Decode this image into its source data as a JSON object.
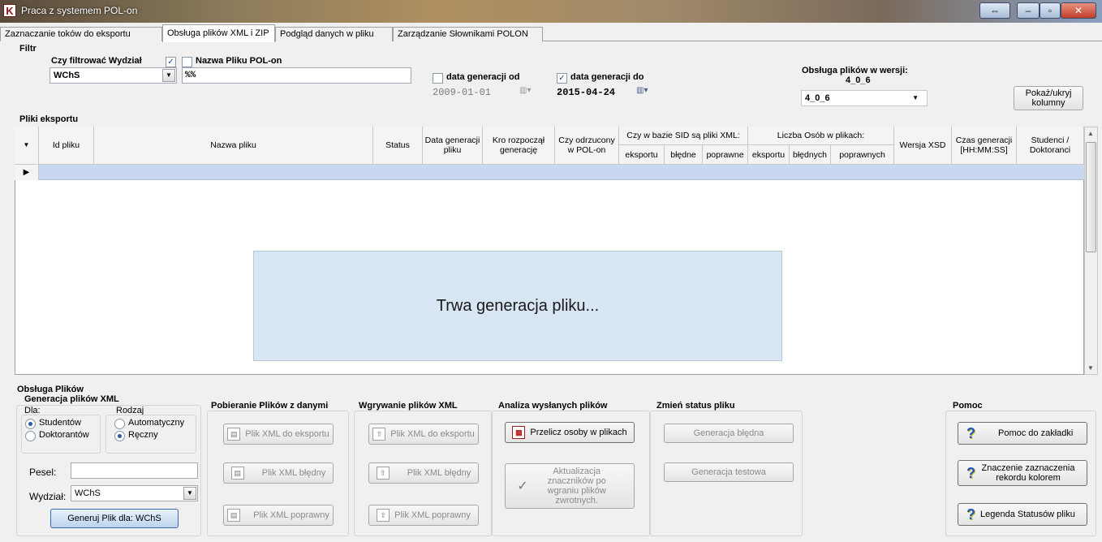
{
  "window": {
    "title": "Praca z systemem POL-on",
    "icon": "app-logo-icon"
  },
  "tabs": [
    {
      "label": "Zaznaczanie toków do eksportu"
    },
    {
      "label": "Obsługa plików XML i ZIP"
    },
    {
      "label": "Podgląd danych w pliku"
    },
    {
      "label": "Zarządzanie Słownikami POLON"
    }
  ],
  "filter": {
    "group_label": "Filtr",
    "filter_wydzial_label": "Czy filtrować Wydział",
    "wydzial_value": "WChS",
    "nazwa_label": "Nazwa Pliku POL-on",
    "nazwa_value": "%%",
    "data_od_label": "data generacji od",
    "data_od_value": "2009-01-01",
    "data_do_label": "data generacji do",
    "data_do_value": "2015-04-24",
    "wersja_label": "Obsługa plików w wersji:",
    "wersja_sub": "4_0_6",
    "wersja_value": "4_0_6",
    "toggle_columns": "Pokaż/ukryj kolumny"
  },
  "grid": {
    "group_label": "Pliki eksportu",
    "headers": {
      "id": "Id pliku",
      "name": "Nazwa pliku",
      "status": "Status",
      "data": "Data generacji pliku",
      "kto": "Kro rozpoczął generację",
      "odrzucony": "Czy odrzucony w POL-on",
      "sid": "Czy w bazie SID są pliki XML:",
      "sid_eksportu": "eksportu",
      "sid_bledne": "błędne",
      "sid_poprawne": "poprawne",
      "osob": "Liczba Osób w plikach:",
      "osob_eksportu": "eksportu",
      "osob_bledne": "błędnych",
      "osob_poprawne": "poprawnych",
      "wersja": "Wersja XSD",
      "czas": "Czas generacji [HH:MM:SS]",
      "studenci": "Studenci / Doktoranci"
    },
    "overlay": "Trwa generacja pliku..."
  },
  "obsluga": {
    "group_label": "Obsługa Plików",
    "gen": {
      "title": "Generacja plików XML",
      "dla_label": "Dla:",
      "studentow": "Studentów",
      "doktorantow": "Doktorantów",
      "rodzaj_label": "Rodzaj",
      "automatyczny": "Automatyczny",
      "reczny": "Ręczny",
      "pesel_label": "Pesel:",
      "pesel_value": "",
      "wydzial_label": "Wydział:",
      "wydzial_value": "WChS",
      "generate_button": "Generuj Plik dla: WChS"
    },
    "pobieranie": {
      "title": "Pobieranie Plików z danymi",
      "b1": "Plik XML do eksportu",
      "b2": "Plik XML błędny",
      "b3": "Plik XML poprawny"
    },
    "wgrywanie": {
      "title": "Wgrywanie plików XML",
      "b1": "Plik XML do eksportu",
      "b2": "Plik XML błędny",
      "b3": "Plik XML poprawny"
    },
    "analiza": {
      "title": "Analiza wysłanych plików",
      "b1": "Przelicz osoby w plikach",
      "b2": "Aktualizacja znaczników po wgraniu plików zwrotnych."
    },
    "status": {
      "title": "Zmień status pliku",
      "b1": "Generacja błędna",
      "b2": "Generacja testowa"
    },
    "pomoc": {
      "title": "Pomoc",
      "b1": "Pomoc do zakładki",
      "b2": "Znaczenie zaznaczenia rekordu kolorem",
      "b3": "Legenda Statusów pliku"
    }
  }
}
